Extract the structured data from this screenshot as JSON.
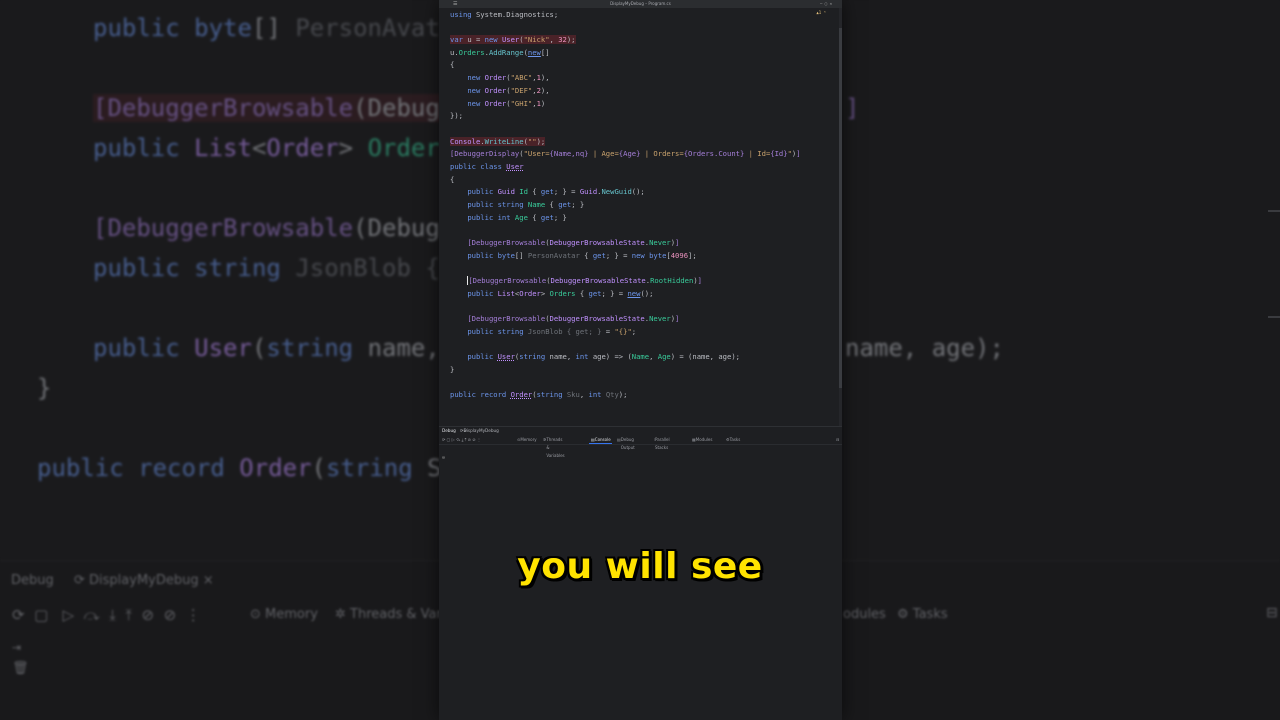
{
  "window": {
    "title": "DisplayMyDebug – Program.cs"
  },
  "background": {
    "lines": [
      "public byte[] PersonAvata",
      "[DebuggerBrowsable(Debug",
      "public List<Order> Orders",
      "[DebuggerBrowsable(Debug",
      "public string JsonBlob {",
      "public User(string name,",
      "}",
      "public record Order(string S",
      "name, age);"
    ],
    "bottom": {
      "tab_debug": "Debug",
      "tab_config": "DisplayMyDebug",
      "tab_close": "×",
      "memory": "Memory",
      "threads": "Threads & Varia",
      "modules": "odules",
      "tasks": "Tasks"
    }
  },
  "code": {
    "lines": [
      "using System.Diagnostics;",
      "",
      "var u = new User(\"Nick\", 32);",
      "u.Orders.AddRange(new[]",
      "{",
      "    new Order(\"ABC\",1),",
      "    new Order(\"DEF\",2),",
      "    new Order(\"GHI\",1)",
      "});",
      "",
      "Console.WriteLine(\"\");",
      "[DebuggerDisplay(\"User={Name,nq} | Age={Age} | Orders={Orders.Count} | Id={Id}\")]",
      "public class User",
      "{",
      "    public Guid Id { get; } = Guid.NewGuid();",
      "    public string Name { get; }",
      "    public int Age { get; }",
      "",
      "    [DebuggerBrowsable(DebuggerBrowsableState.Never)]",
      "    public byte[] PersonAvatar { get; } = new byte[4096];",
      "",
      "    [DebuggerBrowsable(DebuggerBrowsableState.RootHidden)]",
      "    public List<Order> Orders { get; } = new();",
      "",
      "    [DebuggerBrowsable(DebuggerBrowsableState.Never)]",
      "    public string JsonBlob { get; } = \"{}\";",
      "",
      "    public User(string name, int age) => (Name, Age) = (name, age);",
      "}",
      "",
      "public record Order(string Sku, int Qty);"
    ]
  },
  "debug_panel": {
    "tab_debug": "Debug",
    "tab_config": "DisplayMyDebug",
    "tab_close": "×",
    "toolbar": {
      "memory": "Memory",
      "threads": "Threads & Variables",
      "console": "Console",
      "debug_output": "Debug Output",
      "parallel_stacks": "Parallel Stacks",
      "modules": "Modules",
      "tasks": "Tasks"
    }
  },
  "caption": "you will see",
  "colors": {
    "editor_bg": "#1e1f22",
    "keyword": "#6c95eb",
    "type": "#c191ff",
    "string": "#c9a26d",
    "caption": "#ffe300"
  }
}
